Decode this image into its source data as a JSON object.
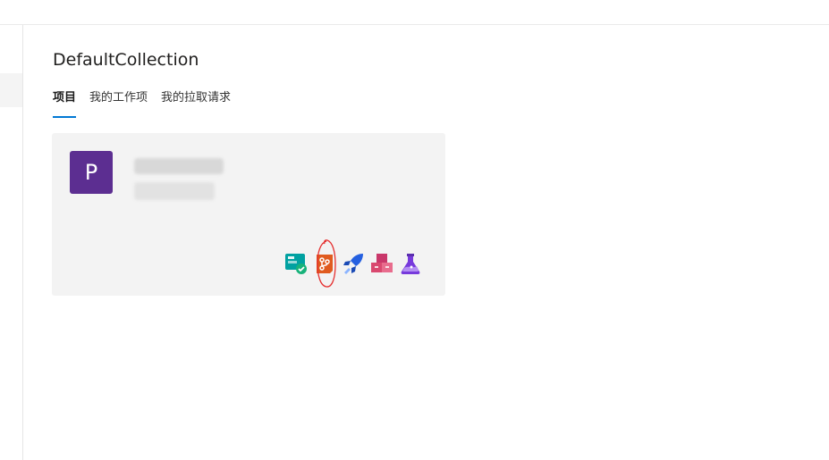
{
  "collection": {
    "title": "DefaultCollection"
  },
  "tabs": [
    {
      "label": "项目",
      "active": true
    },
    {
      "label": "我的工作项",
      "active": false
    },
    {
      "label": "我的拉取请求",
      "active": false
    }
  ],
  "project": {
    "avatar_letter": "P",
    "avatar_color": "#5c2e91",
    "services": [
      {
        "icon": "boards-icon",
        "color": "#009ccc"
      },
      {
        "icon": "repos-icon",
        "color": "#e05b1f"
      },
      {
        "icon": "pipelines-icon",
        "color": "#2560e0"
      },
      {
        "icon": "artifacts-icon",
        "color": "#c9376a"
      },
      {
        "icon": "test-plans-icon",
        "color": "#773adc"
      }
    ]
  },
  "colors": {
    "accent": "#0078d4",
    "annotation": "#e53030"
  }
}
